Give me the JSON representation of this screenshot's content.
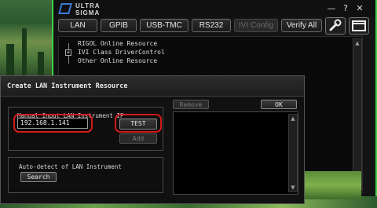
{
  "app": {
    "logo_line1": "ULTRA",
    "logo_line2": "SIGMA",
    "window_controls": [
      "—",
      "?",
      "✕"
    ]
  },
  "toolbar": {
    "tabs": [
      {
        "label": "LAN",
        "enabled": true
      },
      {
        "label": "GPIB",
        "enabled": true
      },
      {
        "label": "USB-TMC",
        "enabled": true
      },
      {
        "label": "RS232",
        "enabled": true
      },
      {
        "label": "IVI Config",
        "enabled": false
      },
      {
        "label": "Verify All",
        "enabled": true
      }
    ],
    "tools_icon": "wrench-icon",
    "window_icon": "window-icon"
  },
  "tree": {
    "items": [
      {
        "label": "RIGOL Online Resource",
        "expander": ""
      },
      {
        "label": "IVI Class DriverControl",
        "expander": "+"
      },
      {
        "label": "Other Online Resource",
        "expander": ""
      }
    ]
  },
  "dialog": {
    "title": "Create LAN Instrument Resource",
    "manual_group_label": "Manual Input LAN Instrument IP",
    "ip_value": "192.168.1.141",
    "test_label": "TEST",
    "add_label": "Add",
    "autodetect_label": "Auto-detect of LAN Instrument",
    "search_label": "Search",
    "remove_label": "Remove",
    "ok_label": "OK"
  },
  "colors": {
    "highlight_ring": "#d11a1a",
    "window_border": "#3fd24a",
    "logo_accent": "#3b7bd6"
  }
}
